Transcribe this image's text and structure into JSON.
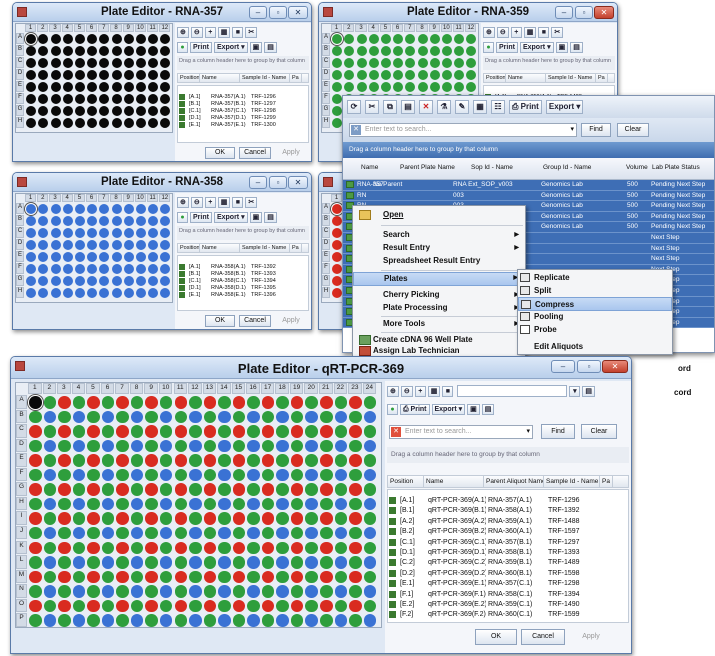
{
  "colors": {
    "black": "#0a0a0a",
    "green": "#2e9e3c",
    "blue": "#3a72d4",
    "red": "#d92b20",
    "selected": "#3e6eb5"
  },
  "plate_rows": [
    "A",
    "B",
    "C",
    "D",
    "E",
    "F",
    "G",
    "H"
  ],
  "plate_cols": [
    "1",
    "2",
    "3",
    "4",
    "5",
    "6",
    "7",
    "8",
    "9",
    "10",
    "11",
    "12"
  ],
  "big_rows": [
    "A",
    "B",
    "C",
    "D",
    "E",
    "F",
    "G",
    "H",
    "I",
    "J",
    "K",
    "L",
    "M",
    "N",
    "O",
    "P"
  ],
  "big_cols": [
    "1",
    "2",
    "3",
    "4",
    "5",
    "6",
    "7",
    "8",
    "9",
    "10",
    "11",
    "12",
    "13",
    "14",
    "15",
    "16",
    "17",
    "18",
    "19",
    "20",
    "21",
    "22",
    "23",
    "24"
  ],
  "side": {
    "print": "Print",
    "export": "Export",
    "group_hint": "Drag a column header here to group by that column",
    "col_position": "Position",
    "col_name": "Name",
    "col_sample": "Sample Id - Name",
    "col_pa": "Pa",
    "ok": "OK",
    "cancel": "Cancel",
    "apply": "Apply"
  },
  "rna357": {
    "title": "Plate Editor - RNA-357",
    "color": "black",
    "rows": [
      [
        "[A.1]",
        "RNA-357(A.1)",
        "TRF-1296"
      ],
      [
        "[B.1]",
        "RNA-357(B.1)",
        "TRF-1297"
      ],
      [
        "[C.1]",
        "RNA-357(C.1)",
        "TRF-1298"
      ],
      [
        "[D.1]",
        "RNA-357(D.1)",
        "TRF-1299"
      ],
      [
        "[E.1]",
        "RNA-357(E.1)",
        "TRF-1300"
      ]
    ]
  },
  "rna359": {
    "title": "Plate Editor - RNA-359",
    "color": "green",
    "rows": [
      [
        "[A.1]",
        "RNA-359(A.1)",
        "TRF-1488"
      ]
    ]
  },
  "rna358": {
    "title": "Plate Editor - RNA-358",
    "color": "blue",
    "rows": [
      [
        "[A.1]",
        "RNA-358(A.1)",
        "TRF-1392"
      ],
      [
        "[B.1]",
        "RNA-358(B.1)",
        "TRF-1393"
      ],
      [
        "[C.1]",
        "RNA-358(C.1)",
        "TRF-1394"
      ],
      [
        "[D.1]",
        "RNA-358(D.1)",
        "TRF-1395"
      ],
      [
        "[E.1]",
        "RNA-358(E.1)",
        "TRF-1396"
      ]
    ]
  },
  "qrt": {
    "title": "Plate Editor - qRT-PCR-369",
    "search_placeholder": "Enter text to search...",
    "find": "Find",
    "clear": "Clear",
    "col_parent": "Parent Aliquot Name",
    "rows": [
      [
        "[A.1]",
        "qRT-PCR-369(A.1)",
        "RNA-357(A.1)",
        "TRF-1296"
      ],
      [
        "[B.1]",
        "qRT-PCR-369(B.1)",
        "RNA-358(A.1)",
        "TRF-1392"
      ],
      [
        "[A.2]",
        "qRT-PCR-369(A.2)",
        "RNA-359(A.1)",
        "TRF-1488"
      ],
      [
        "[B.2]",
        "qRT-PCR-369(B.2)",
        "RNA-360(A.1)",
        "TRF-1597"
      ],
      [
        "[C.1]",
        "qRT-PCR-369(C.1)",
        "RNA-357(B.1)",
        "TRF-1297"
      ],
      [
        "[D.1]",
        "qRT-PCR-369(D.1)",
        "RNA-358(B.1)",
        "TRF-1393"
      ],
      [
        "[C.2]",
        "qRT-PCR-369(C.2)",
        "RNA-359(B.1)",
        "TRF-1489"
      ],
      [
        "[D.2]",
        "qRT-PCR-369(D.2)",
        "RNA-360(B.1)",
        "TRF-1598"
      ],
      [
        "[E.1]",
        "qRT-PCR-369(E.1)",
        "RNA-357(C.1)",
        "TRF-1298"
      ],
      [
        "[F.1]",
        "qRT-PCR-369(F.1)",
        "RNA-358(C.1)",
        "TRF-1394"
      ],
      [
        "[E.2]",
        "qRT-PCR-369(E.2)",
        "RNA-359(C.1)",
        "TRF-1490"
      ],
      [
        "[F.2]",
        "qRT-PCR-369(F.2)",
        "RNA-360(C.1)",
        "TRF-1599"
      ]
    ]
  },
  "lab": {
    "search_placeholder": "Enter text to search...",
    "find": "Find",
    "clear": "Clear",
    "print": "Print",
    "export": "Export",
    "group_hint": "Drag a column header here to group by that column",
    "headers": [
      "Name",
      "Parent Plate Name",
      "Sop Id - Name",
      "Group Id - Name",
      "Volume",
      "Lab Plate Status"
    ],
    "rows": [
      [
        "RNA-357",
        "No Parent",
        "RNA Ext_SOP_v003",
        "Genomics Lab",
        "500",
        "Pending Next Step"
      ],
      [
        "RN",
        "",
        "003",
        "Genomics Lab",
        "500",
        "Pending Next Step"
      ],
      [
        "RN",
        "",
        "003",
        "Genomics Lab",
        "500",
        "Pending Next Step"
      ],
      [
        "RN",
        "",
        "003",
        "Genomics Lab",
        "500",
        "Pending Next Step"
      ],
      [
        "RN",
        "",
        "003",
        "Genomics Lab",
        "500",
        "Pending Next Step"
      ],
      [
        "RN",
        "",
        "",
        "",
        "",
        "Next Step"
      ],
      [
        "RN",
        "",
        "",
        "",
        "",
        "Next Step"
      ],
      [
        "RN",
        "",
        "",
        "",
        "",
        "Next Step"
      ],
      [
        "RN",
        "",
        "",
        "",
        "",
        "Next Step"
      ],
      [
        "RN",
        "",
        "",
        "",
        "",
        "Next Step"
      ],
      [
        "RN",
        "",
        "",
        "",
        "",
        "Next Step"
      ],
      [
        "RN",
        "",
        "",
        "",
        "",
        "Next Step"
      ],
      [
        "RN",
        "",
        "",
        "",
        "",
        "Next Step"
      ],
      [
        "RN",
        "",
        "",
        "",
        "",
        "Next Step"
      ]
    ]
  },
  "menu": {
    "open": "Open",
    "search": "Search",
    "result_entry": "Result Entry",
    "spreadsheet": "Spreadsheet Result Entry",
    "plates": "Plates",
    "cherry": "Cherry Picking",
    "plate_processing": "Plate Processing",
    "more_tools": "More Tools",
    "create": "Create cDNA 96 Well Plate",
    "assign": "Assign Lab Technician"
  },
  "submenu": {
    "replicate": "Replicate",
    "split": "Split",
    "compress": "Compress",
    "pooling": "Pooling",
    "probe": "Probe",
    "edit_aliquots": "Edit Aliquots"
  },
  "partial": {
    "ord1": "ord",
    "ord2": "cord"
  }
}
